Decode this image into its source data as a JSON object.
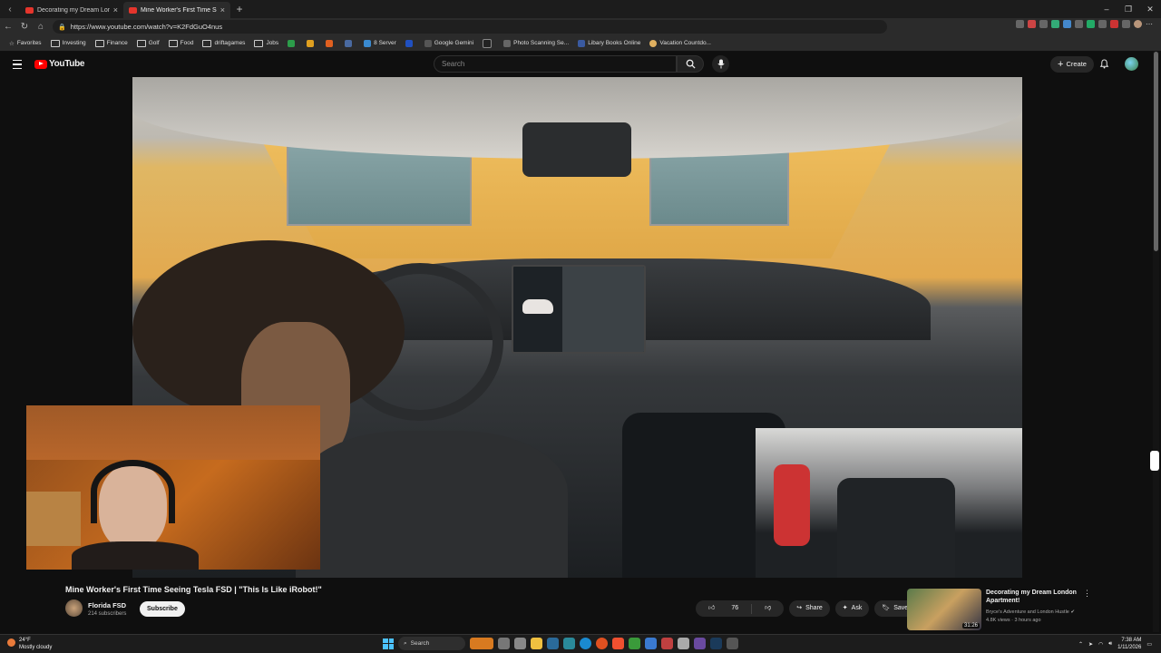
{
  "browser": {
    "tabs": [
      {
        "label": "Decorating my Dream London Ap",
        "active": false
      },
      {
        "label": "Mine Worker's First Time See",
        "active": true
      }
    ],
    "url": "https://www.youtube.com/watch?v=K2FdGuO4nus",
    "bookmarks": [
      {
        "label": "Favorites",
        "icon": "star-icon"
      },
      {
        "label": "Investing",
        "icon": "folder-icon"
      },
      {
        "label": "Finance",
        "icon": "folder-icon"
      },
      {
        "label": "Golf",
        "icon": "folder-icon"
      },
      {
        "label": "Food",
        "icon": "folder-icon"
      },
      {
        "label": "driftagames",
        "icon": "folder-icon"
      },
      {
        "label": "Jobs",
        "icon": "folder-icon"
      },
      {
        "label": "8 Server",
        "icon": "site-icon"
      },
      {
        "label": "Google Gemini",
        "icon": "site-icon"
      },
      {
        "label": "Photo Scanning Se...",
        "icon": "site-icon"
      },
      {
        "label": "Libary Books Online",
        "icon": "site-icon"
      },
      {
        "label": "Vacation Countdo...",
        "icon": "site-icon"
      }
    ]
  },
  "youtube": {
    "logo_text": "YouTube",
    "search_placeholder": "Search",
    "create_label": "Create"
  },
  "video": {
    "title": "Mine Worker's First Time Seeing Tesla FSD | \"This Is Like iRobot!\"",
    "channel": "Florida FSD",
    "subscribers": "214 subscribers",
    "subscribe_label": "Subscribe",
    "likes": "76",
    "share_label": "Share",
    "ask_label": "Ask",
    "save_label": "Save"
  },
  "recommended": {
    "title": "Decorating my Dream London Apartment!",
    "channel": "Bryce's Adventure and London Hustle",
    "meta": "4.8K views · 3 hours ago",
    "duration": "31:26"
  },
  "taskbar": {
    "temp": "24°F",
    "weather": "Mostly cloudy",
    "search_label": "Search",
    "time": "7:38 AM",
    "date": "1/11/2026"
  },
  "colors": {
    "accent": "#ff0000",
    "background": "#0f0f0f"
  }
}
